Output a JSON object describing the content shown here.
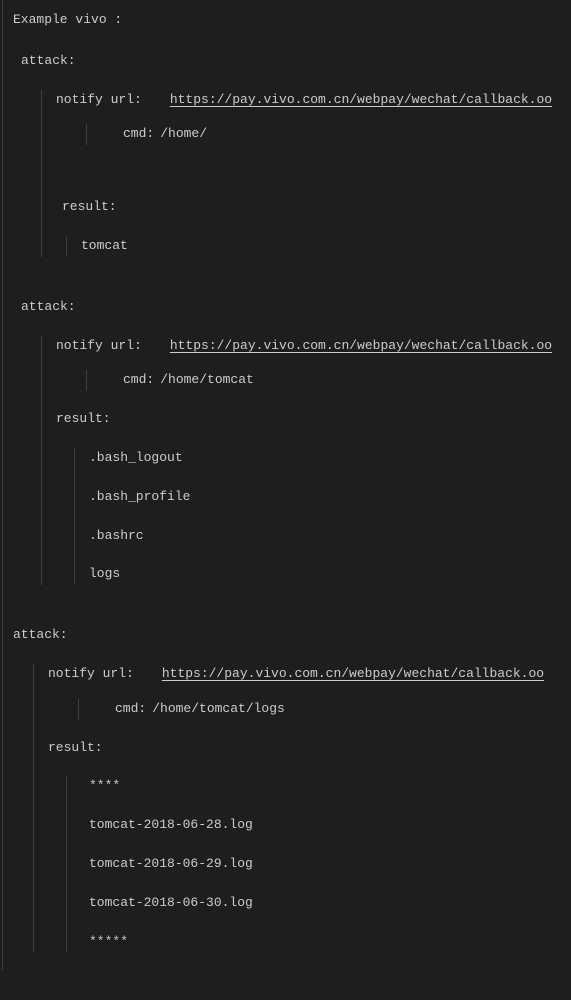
{
  "header": {
    "title": "Example  vivo :"
  },
  "attacks": [
    {
      "attack_label": "attack:",
      "notify_label": "notify url:",
      "notify_url": "https://pay.vivo.com.cn/webpay/wechat/callback.oo",
      "cmd_label": "cmd:",
      "cmd_value": "/home/",
      "result_label": "result:",
      "result_items": [
        "tomcat"
      ]
    },
    {
      "attack_label": "attack:",
      "notify_label": "notify url:",
      "notify_url": "https://pay.vivo.com.cn/webpay/wechat/callback.oo",
      "cmd_label": "cmd:",
      "cmd_value": "/home/tomcat",
      "result_label": "result:",
      "result_items": [
        ".bash_logout",
        ".bash_profile",
        ".bashrc",
        "logs"
      ]
    },
    {
      "attack_label": "attack:",
      "notify_label": "notify url:",
      "notify_url": "https://pay.vivo.com.cn/webpay/wechat/callback.oo",
      "cmd_label": "cmd:",
      "cmd_value": "/home/tomcat/logs",
      "result_label": "result:",
      "result_items": [
        "****",
        "tomcat-2018-06-28.log",
        "tomcat-2018-06-29.log",
        "tomcat-2018-06-30.log",
        "*****"
      ]
    }
  ]
}
